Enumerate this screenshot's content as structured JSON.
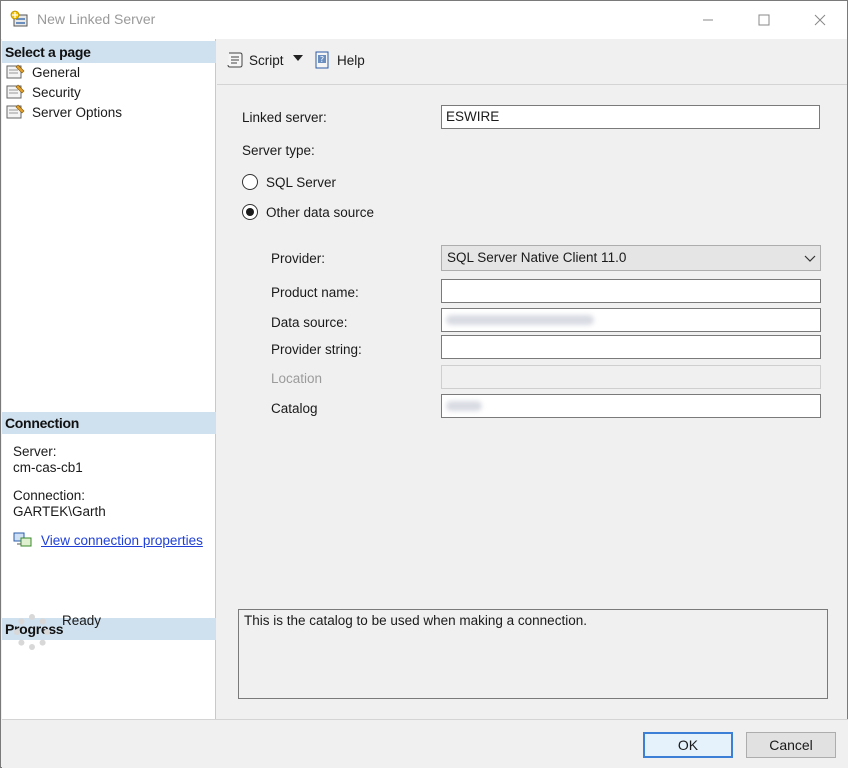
{
  "window": {
    "title": "New Linked Server"
  },
  "left_pane": {
    "select_page_header": "Select a page",
    "pages": [
      {
        "label": "General"
      },
      {
        "label": "Security"
      },
      {
        "label": "Server Options"
      }
    ],
    "connection_header": "Connection",
    "server_label": "Server:",
    "server_value": "cm-cas-cb1",
    "connection_label": "Connection:",
    "connection_value": "GARTEK\\Garth",
    "view_connection_link": "View connection properties",
    "progress_header": "Progress",
    "progress_status": "Ready"
  },
  "toolbar": {
    "script_label": "Script",
    "help_label": "Help"
  },
  "form": {
    "linked_server_label": "Linked server:",
    "linked_server_value": "ESWIRE",
    "server_type_label": "Server type:",
    "radio_sql_server": "SQL Server",
    "radio_other": "Other data source",
    "selected_server_type": "Other data source",
    "provider_label": "Provider:",
    "provider_value": "SQL Server Native Client 11.0",
    "product_name_label": "Product name:",
    "product_name_value": "",
    "data_source_label": "Data source:",
    "provider_string_label": "Provider string:",
    "provider_string_value": "",
    "location_label": "Location",
    "location_value": "",
    "catalog_label": "Catalog"
  },
  "description": "This is the catalog to be used when making a connection.",
  "footer": {
    "ok_label": "OK",
    "cancel_label": "Cancel"
  },
  "colors": {
    "pane_header_bg": "#cfe0ee",
    "link": "#1f3fd6",
    "default_button_border": "#3c7fd6"
  }
}
